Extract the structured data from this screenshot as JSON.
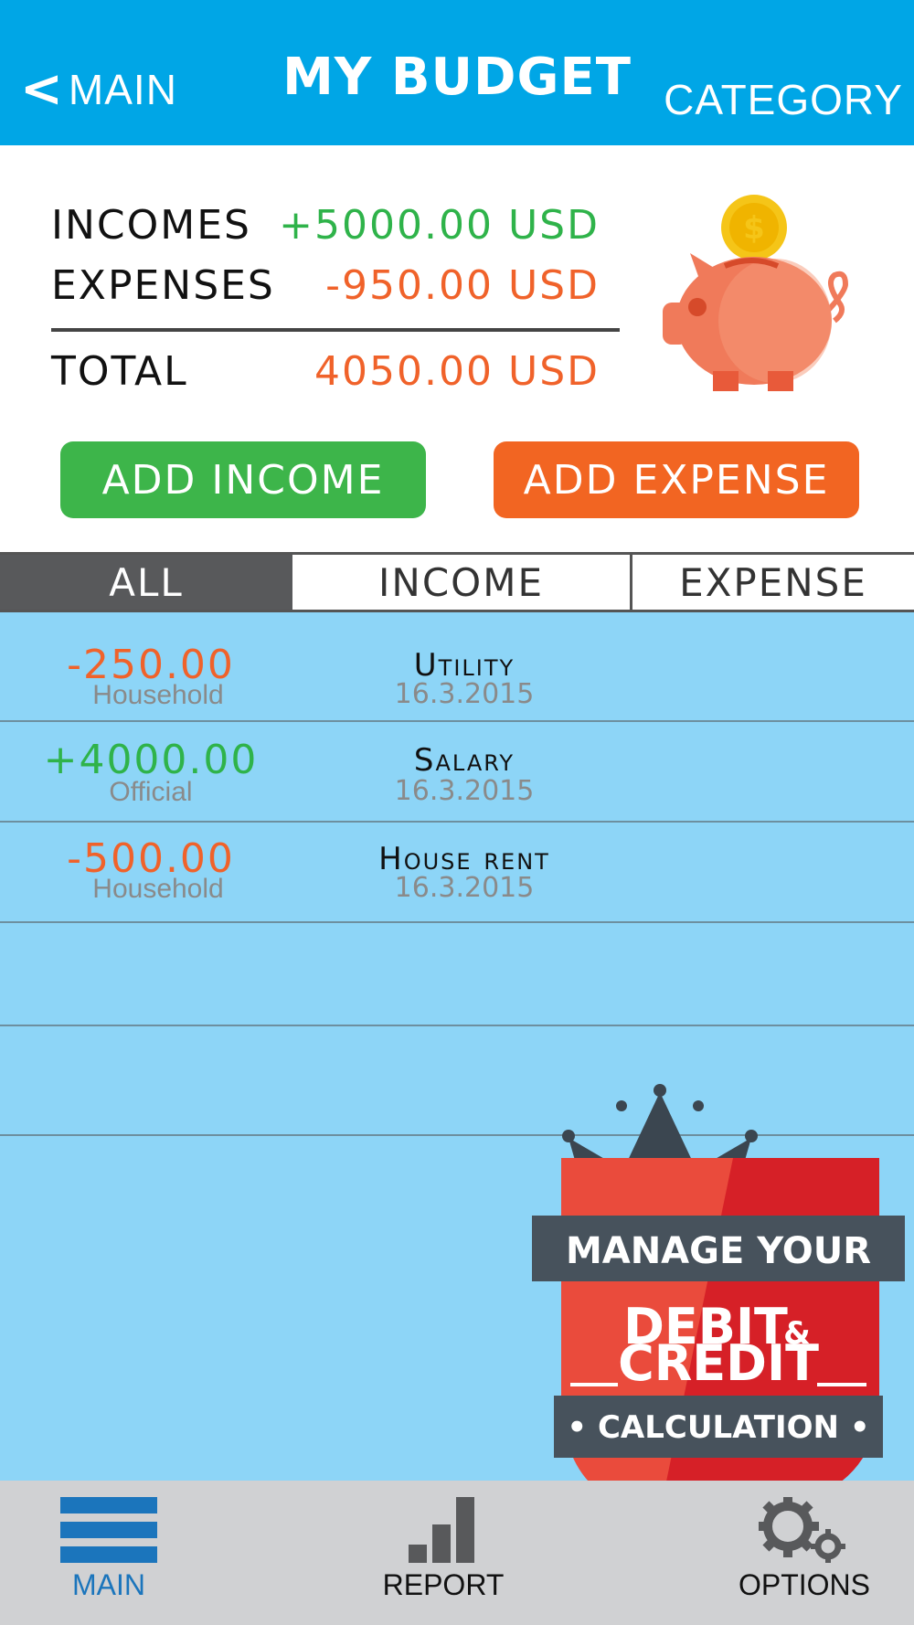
{
  "header": {
    "back_label": "MAIN",
    "title": "MY BUDGET",
    "category_label": "CATEGORY"
  },
  "summary": {
    "incomes_label": "INCOMES",
    "incomes_value": "+5000.00 USD",
    "expenses_label": "EXPENSES",
    "expenses_value": "-950.00 USD",
    "total_label": "TOTAL",
    "total_value": "4050.00 USD"
  },
  "buttons": {
    "add_income": "ADD INCOME",
    "add_expense": "ADD EXPENSE"
  },
  "tabs": {
    "all": "ALL",
    "income": "INCOME",
    "expense": "EXPENSE",
    "selected": "all"
  },
  "transactions": [
    {
      "amount": "-250.00",
      "category": "Household",
      "name": "Utility",
      "date": "16.3.2015",
      "kind": "expense"
    },
    {
      "amount": "+4000.00",
      "category": "Official",
      "name": "Salary",
      "date": "16.3.2015",
      "kind": "income"
    },
    {
      "amount": "-500.00",
      "category": "Household",
      "name": "House rent",
      "date": "16.3.2015",
      "kind": "expense"
    }
  ],
  "promo": {
    "line1": "MANAGE YOUR",
    "line2": "DEBIT",
    "amp": "&",
    "line3": "CREDIT",
    "line4": "• CALCULATION •"
  },
  "bottom_nav": {
    "main": "MAIN",
    "report": "REPORT",
    "options": "OPTIONS",
    "active": "main"
  },
  "colors": {
    "header_bg": "#00a6e6",
    "income_green": "#2fb34a",
    "expense_orange": "#f0622a",
    "list_bg": "#8dd5f7",
    "tab_selected_bg": "#58595b",
    "nav_active": "#1b75bc"
  },
  "icons": {
    "back": "chevron-left-icon",
    "piggy": "piggy-bank-icon",
    "main": "list-icon",
    "report": "bar-chart-icon",
    "options": "gears-icon"
  }
}
